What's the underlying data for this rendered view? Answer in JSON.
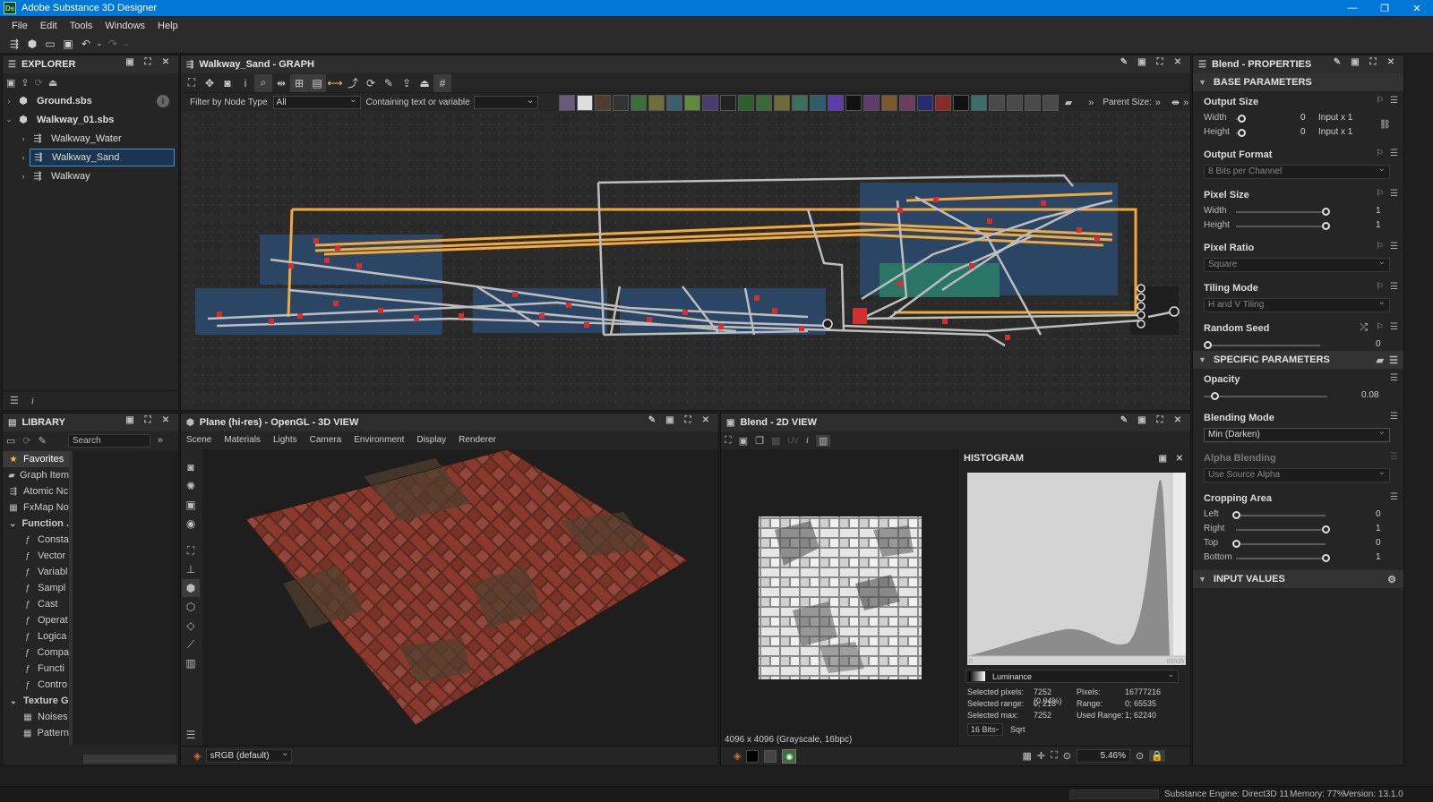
{
  "app": {
    "title": "Adobe Substance 3D Designer",
    "logo": "Ds"
  },
  "menu": [
    "File",
    "Edit",
    "Tools",
    "Windows",
    "Help"
  ],
  "explorer": {
    "title": "EXPLORER",
    "items": [
      {
        "label": "Ground.sbs"
      },
      {
        "label": "Walkway_01.sbs"
      },
      {
        "label": "Walkway_Water"
      },
      {
        "label": "Walkway_Sand"
      },
      {
        "label": "Walkway"
      }
    ]
  },
  "graph": {
    "title": "Walkway_Sand - GRAPH",
    "filter_label": "Filter by Node Type",
    "filter_value": "All",
    "contain_label": "Containing text or variable",
    "parent_size": "Parent Size:"
  },
  "library": {
    "title": "LIBRARY",
    "search_placeholder": "Search",
    "items": [
      {
        "label": "Favorites",
        "icon": "star-icon",
        "level": 0
      },
      {
        "label": "Graph Item",
        "icon": "graph-item-icon",
        "level": 0
      },
      {
        "label": "Atomic Nc",
        "icon": "atomic-icon",
        "level": 0
      },
      {
        "label": "FxMap No",
        "icon": "fxmap-icon",
        "level": 0
      },
      {
        "label": "Function .",
        "icon": "chevron-down-icon",
        "level": 0
      },
      {
        "label": "Consta",
        "icon": "function-icon",
        "level": 1
      },
      {
        "label": "Vector",
        "icon": "function-icon",
        "level": 1
      },
      {
        "label": "Variabl",
        "icon": "function-icon",
        "level": 1
      },
      {
        "label": "Sampl",
        "icon": "function-icon",
        "level": 1
      },
      {
        "label": "Cast",
        "icon": "function-icon",
        "level": 1
      },
      {
        "label": "Operat",
        "icon": "function-icon",
        "level": 1
      },
      {
        "label": "Logica",
        "icon": "function-icon",
        "level": 1
      },
      {
        "label": "Compa",
        "icon": "function-icon",
        "level": 1
      },
      {
        "label": "Functi",
        "icon": "function-icon",
        "level": 1
      },
      {
        "label": "Contro",
        "icon": "function-icon",
        "level": 1
      },
      {
        "label": "Texture G",
        "icon": "chevron-down-icon",
        "level": 0
      },
      {
        "label": "Noises",
        "icon": "noise-icon",
        "level": 1
      },
      {
        "label": "Pattern",
        "icon": "pattern-icon",
        "level": 1
      }
    ]
  },
  "view3d": {
    "title": "Plane (hi-res) - OpenGL - 3D VIEW",
    "menu": [
      "Scene",
      "Materials",
      "Lights",
      "Camera",
      "Environment",
      "Display",
      "Renderer"
    ],
    "colorspace": "sRGB (default)"
  },
  "view2d": {
    "title": "Blend - 2D VIEW",
    "uv": "UV",
    "info": "4096 x 4096 (Grayscale, 16bpc)",
    "zoom": "5.46%"
  },
  "histogram": {
    "title": "HISTOGRAM",
    "axis_min": "0",
    "axis_max": "65535",
    "channel": "Luminance",
    "bits": "16 Bits",
    "mode": "Sqrt",
    "stats": [
      {
        "k": "Selected pixels:",
        "v": "7252 (0.04%)",
        "k2": "Pixels:",
        "v2": "16777216"
      },
      {
        "k": "Selected range:",
        "v": "0; 218",
        "k2": "Range:",
        "v2": "0; 65535"
      },
      {
        "k": "Selected max:",
        "v": "7252",
        "k2": "Used Range:",
        "v2": "1; 62240"
      }
    ]
  },
  "properties": {
    "title": "Blend - PROPERTIES",
    "base_section": "BASE PARAMETERS",
    "specific_section": "SPECIFIC PARAMETERS",
    "input_section": "INPUT VALUES",
    "output_size": {
      "label": "Output Size",
      "width_label": "Width",
      "height_label": "Height",
      "width": "0",
      "height": "0",
      "width_rel": "Input x 1",
      "height_rel": "Input x 1"
    },
    "output_format": {
      "label": "Output Format",
      "value": "8 Bits per Channel"
    },
    "pixel_size": {
      "label": "Pixel Size",
      "width_label": "Width",
      "height_label": "Height",
      "width": "1",
      "height": "1"
    },
    "pixel_ratio": {
      "label": "Pixel Ratio",
      "value": "Square"
    },
    "tiling_mode": {
      "label": "Tiling Mode",
      "value": "H and V Tiling"
    },
    "random_seed": {
      "label": "Random Seed",
      "value": "0"
    },
    "opacity": {
      "label": "Opacity",
      "value": "0.08",
      "level": 0.08
    },
    "blending_mode": {
      "label": "Blending Mode",
      "value": "Min (Darken)"
    },
    "alpha_blending": {
      "label": "Alpha Blending",
      "value": "Use Source Alpha"
    },
    "cropping": {
      "label": "Cropping Area",
      "rows": [
        {
          "label": "Left",
          "value": "0",
          "level": 0
        },
        {
          "label": "Right",
          "value": "1",
          "level": 1
        },
        {
          "label": "Top",
          "value": "0",
          "level": 0
        },
        {
          "label": "Bottom",
          "value": "1",
          "level": 1
        }
      ]
    }
  },
  "status": {
    "engine": "Substance Engine: Direct3D 11",
    "memory": "Memory: 77%",
    "version": "Version: 13.1.0"
  },
  "colors": {
    "accent": "#0078d7",
    "wire_orange": "#f2a93b",
    "wire_gray": "#bdbdbd",
    "frame_blue": "#2c4a6e",
    "frame_green": "#2a7a66",
    "node_red": "#d32f2f"
  }
}
